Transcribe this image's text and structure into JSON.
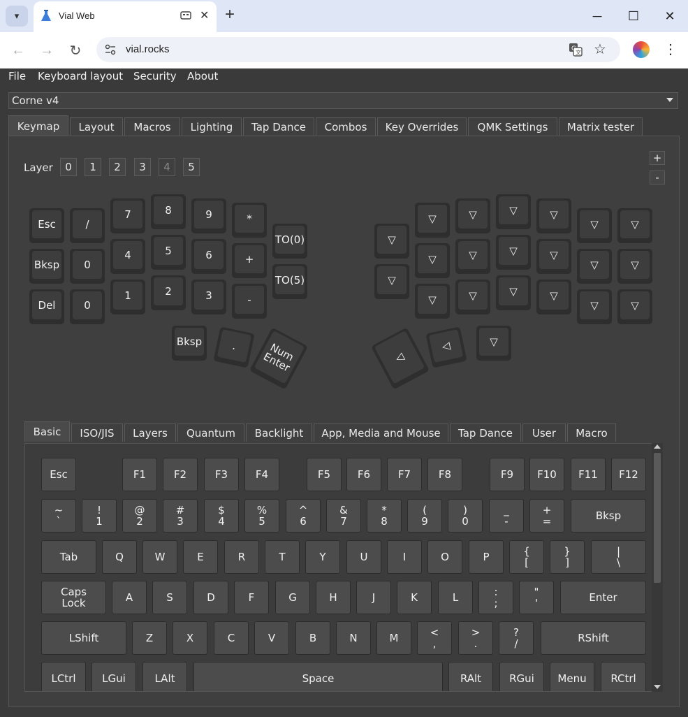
{
  "browser": {
    "tab_title": "Vial Web",
    "url": "vial.rocks",
    "new_tab": "+",
    "close": "✕"
  },
  "menu": [
    "File",
    "Keyboard layout",
    "Security",
    "About"
  ],
  "device": "Corne v4",
  "tabs": [
    "Keymap",
    "Layout",
    "Macros",
    "Lighting",
    "Tap Dance",
    "Combos",
    "Key Overrides",
    "QMK Settings",
    "Matrix tester"
  ],
  "active_tab": "Keymap",
  "layer_label": "Layer",
  "layers": [
    "0",
    "1",
    "2",
    "3",
    "4",
    "5"
  ],
  "layer_disabled": "4",
  "zoom_in": "+",
  "zoom_out": "-",
  "keymap": {
    "left": [
      "Esc",
      "/",
      "7",
      "8",
      "9",
      "*",
      "TO(0)",
      "Bksp",
      "0",
      "4",
      "5",
      "6",
      "+",
      "TO(5)",
      "Del",
      "0",
      "1",
      "2",
      "3",
      "-",
      "Bksp",
      ".",
      "Num\nEnter"
    ],
    "right_symbol": "▽",
    "right_thumb": [
      "◁",
      "◁",
      "▽"
    ]
  },
  "keycode_tabs": [
    "Basic",
    "ISO/JIS",
    "Layers",
    "Quantum",
    "Backlight",
    "App, Media and Mouse",
    "Tap Dance",
    "User",
    "Macro"
  ],
  "active_keycode_tab": "Basic",
  "keycodes": {
    "row0": [
      "Esc",
      "F1",
      "F2",
      "F3",
      "F4",
      "F5",
      "F6",
      "F7",
      "F8",
      "F9",
      "F10",
      "F11",
      "F12"
    ],
    "row1": [
      "~\n`",
      "!\n1",
      "@\n2",
      "#\n3",
      "$\n4",
      "%\n5",
      "^\n6",
      "&\n7",
      "*\n8",
      "(\n9",
      ")\n0",
      "_\n-",
      "+\n=",
      "Bksp"
    ],
    "row2": [
      "Tab",
      "Q",
      "W",
      "E",
      "R",
      "T",
      "Y",
      "U",
      "I",
      "O",
      "P",
      "{\n[",
      "}\n]",
      "|\n\\"
    ],
    "row3": [
      "Caps\nLock",
      "A",
      "S",
      "D",
      "F",
      "G",
      "H",
      "J",
      "K",
      "L",
      ":\n;",
      "\"\n'",
      "Enter"
    ],
    "row4": [
      "LShift",
      "Z",
      "X",
      "C",
      "V",
      "B",
      "N",
      "M",
      "<\n,",
      ">\n.",
      "?\n/",
      "RShift"
    ],
    "row5": [
      "LCtrl",
      "LGui",
      "LAlt",
      "Space",
      "RAlt",
      "RGui",
      "Menu",
      "RCtrl"
    ]
  }
}
